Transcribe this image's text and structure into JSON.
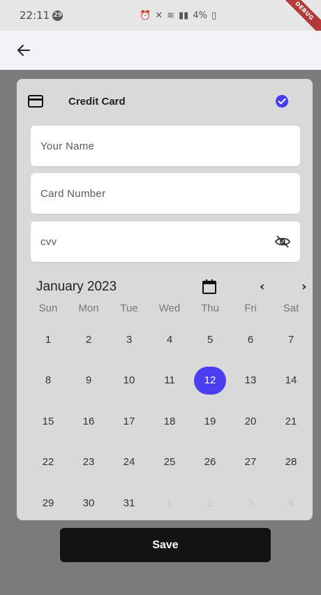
{
  "status_bar": {
    "time": "22:11",
    "notification_count": "29",
    "battery": "4%",
    "debug_label": "DEBUG"
  },
  "card": {
    "title": "Credit Card",
    "name_placeholder": "Your Name",
    "number_placeholder": "Card Number",
    "cvv_placeholder": "cvv"
  },
  "calendar": {
    "month_label": "January 2023",
    "prev_label": "‹",
    "next_label": "›",
    "weekdays": [
      "Sun",
      "Mon",
      "Tue",
      "Wed",
      "Thu",
      "Fri",
      "Sat"
    ],
    "weeks": [
      [
        "1",
        "2",
        "3",
        "4",
        "5",
        "6",
        "7"
      ],
      [
        "8",
        "9",
        "10",
        "11",
        "12",
        "13",
        "14"
      ],
      [
        "15",
        "16",
        "17",
        "18",
        "19",
        "20",
        "21"
      ],
      [
        "22",
        "23",
        "24",
        "25",
        "26",
        "27",
        "28"
      ],
      [
        "29",
        "30",
        "31",
        "1",
        "2",
        "3",
        "4"
      ]
    ],
    "selected_day": "12",
    "accent_color": "#4a3df0"
  },
  "actions": {
    "save_label": "Save"
  },
  "icons": {
    "back": "arrow-back-icon",
    "card": "credit-card-icon",
    "check": "check-circle-icon",
    "visibility": "visibility-off-icon",
    "calendar": "calendar-icon"
  }
}
